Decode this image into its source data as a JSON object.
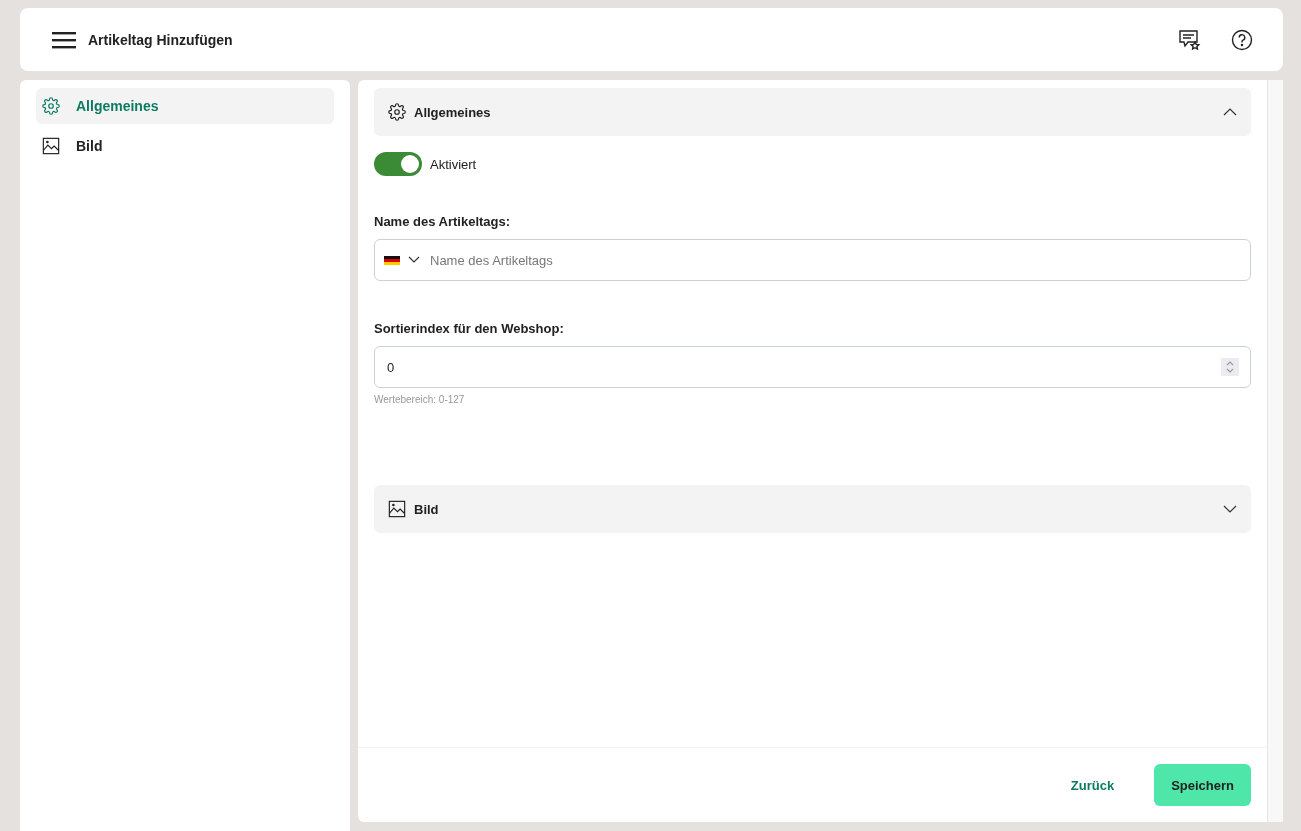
{
  "header": {
    "title": "Artikeltag Hinzufügen"
  },
  "sidebar": {
    "items": [
      {
        "kind": "gear",
        "label": "Allgemeines",
        "selected": true
      },
      {
        "kind": "image",
        "label": "Bild",
        "selected": false
      }
    ]
  },
  "sections": [
    {
      "kind": "gear",
      "title": "Allgemeines",
      "expanded": true,
      "toggle": {
        "label": "Aktiviert",
        "on": true
      },
      "fields": [
        {
          "kind": "translated",
          "label": "Name des Artikeltags:",
          "placeholder": "Name des Artikeltags"
        },
        {
          "kind": "number",
          "label": "Sortierindex für den Webshop:",
          "value": "0",
          "hint": "Wertebereich: 0-127"
        }
      ]
    },
    {
      "kind": "image",
      "title": "Bild",
      "expanded": false
    }
  ],
  "footer": {
    "back": "Zurück",
    "save": "Speichern"
  }
}
